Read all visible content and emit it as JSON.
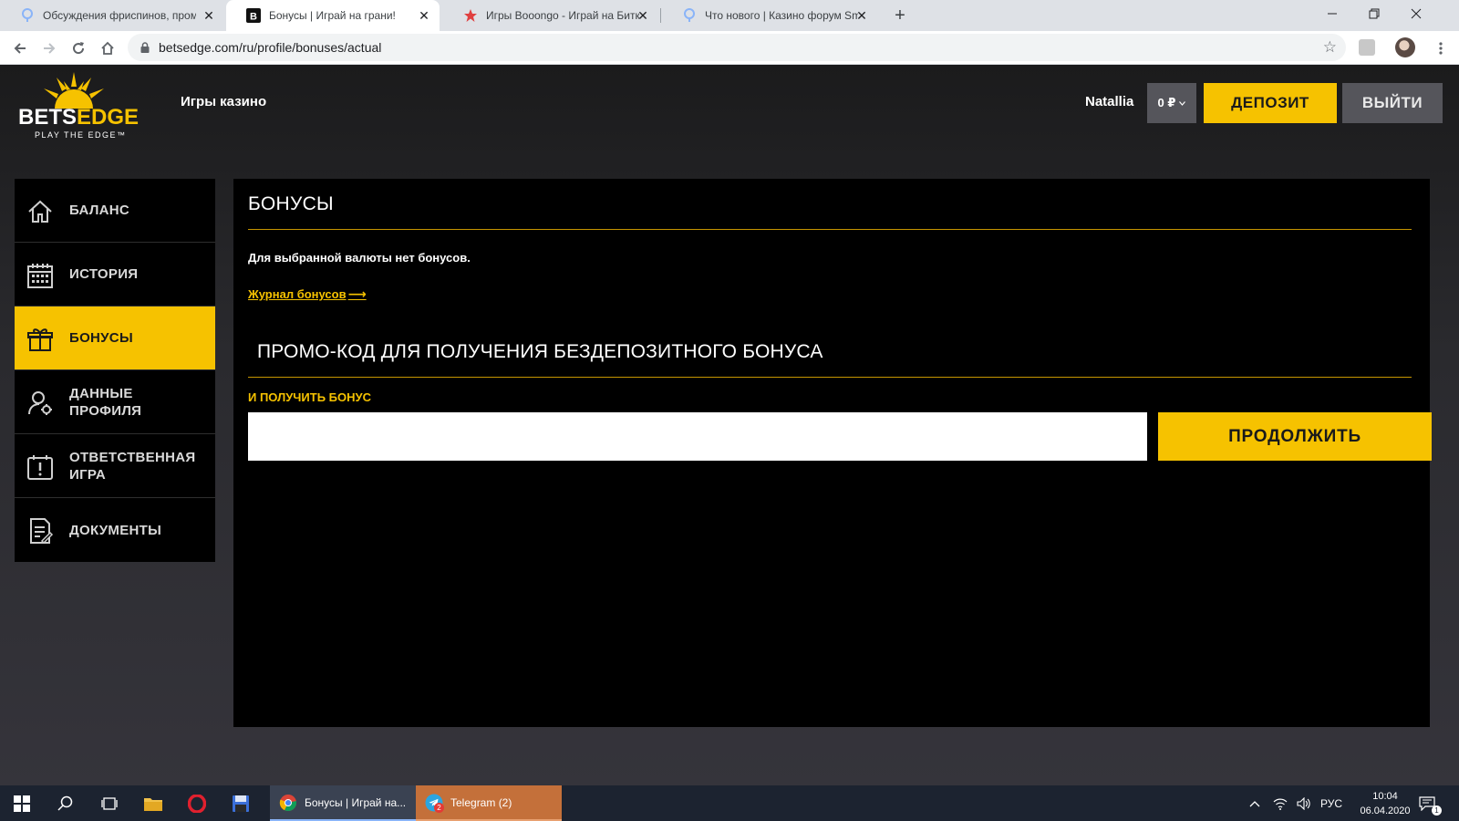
{
  "browser": {
    "tabs": [
      {
        "title": "Обсуждения фриспинов, промо",
        "favicon": "forum-pin-icon",
        "active": false
      },
      {
        "title": "Бонусы | Играй на грани!",
        "favicon": "betsedge-b-icon",
        "active": true
      },
      {
        "title": "Игры Booongo - Играй на Битк",
        "favicon": "red-star-icon",
        "active": false
      },
      {
        "title": "Что нового | Казино форум Smo",
        "favicon": "forum-pin-icon",
        "active": false
      }
    ],
    "url": "betsedge.com/ru/profile/bonuses/actual"
  },
  "header": {
    "logo_text_white": "BETS",
    "logo_text_yellow": "EDGE",
    "logo_tagline": "PLAY THE EDGE™",
    "nav_casino": "Игры казино",
    "username": "Natallia",
    "balance": "0 ₽",
    "deposit_label": "ДЕПОЗИТ",
    "logout_label": "ВЫЙТИ"
  },
  "sidebar": {
    "items": [
      {
        "label": "БАЛАНС",
        "icon": "home-icon"
      },
      {
        "label": "ИСТОРИЯ",
        "icon": "calendar-icon"
      },
      {
        "label": "БОНУСЫ",
        "icon": "gift-icon"
      },
      {
        "label": "ДАННЫЕ ПРОФИЛЯ",
        "icon": "profile-settings-icon"
      },
      {
        "label": "ОТВЕТСТВЕННАЯ ИГРА",
        "icon": "calendar-alert-icon"
      },
      {
        "label": "ДОКУМЕНТЫ",
        "icon": "document-icon"
      }
    ],
    "active_index": 2
  },
  "main": {
    "title": "БОНУСЫ",
    "no_bonus_text": "Для выбранной валюты нет бонусов.",
    "journal_link": "Журнал бонусов",
    "promo_title": "ПРОМО-КОД ДЛЯ ПОЛУЧЕНИЯ БЕЗДЕПОЗИТНОГО БОНУСА",
    "promo_subtitle": "И ПОЛУЧИТЬ БОНУС",
    "promo_input_value": "",
    "continue_label": "ПРОДОЛЖИТЬ"
  },
  "taskbar": {
    "apps": [
      {
        "label": "Бонусы | Играй на...",
        "icon": "chrome-icon"
      },
      {
        "label": "Telegram (2)",
        "icon": "telegram-icon"
      }
    ],
    "telegram_badge": "2",
    "language": "РУС",
    "time": "10:04",
    "date": "06.04.2020",
    "notification_count": "1"
  },
  "colors": {
    "accent_yellow": "#f6c200",
    "panel_black": "#000000",
    "button_gray": "#55555b"
  }
}
